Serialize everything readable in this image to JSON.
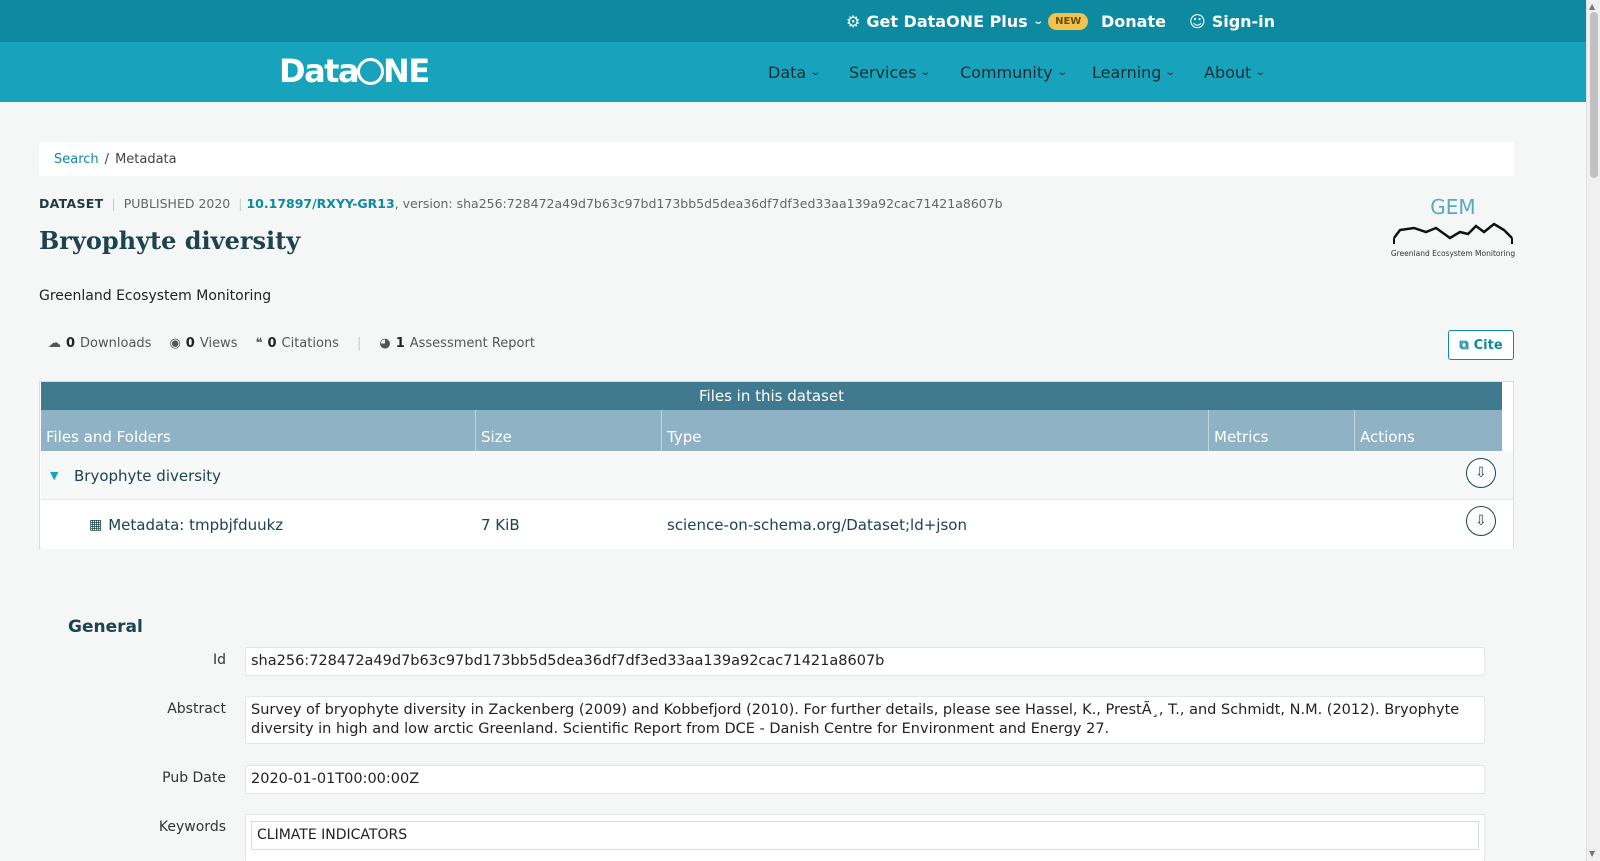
{
  "topbar": {
    "plus_label": "Get DataONE Plus",
    "new_badge": "NEW",
    "donate_label": "Donate",
    "signin_label": "Sign-in"
  },
  "navbar": {
    "logo_left": "Data",
    "logo_right": "NE",
    "items": [
      "Data",
      "Services",
      "Community",
      "Learning",
      "About"
    ]
  },
  "breadcrumb": {
    "search": "Search",
    "separator": "/",
    "current": "Metadata"
  },
  "dataset": {
    "type": "DATASET",
    "published": "PUBLISHED 2020",
    "doi": "10.17897/RXYY-GR13",
    "version": ", version: sha256:728472a49d7b63c97bd173bb5d5dea36df7df3ed33aa139a92cac71421a8607b",
    "title": "Bryophyte diversity",
    "organization": "Greenland Ecosystem Monitoring",
    "gem_logo_text": "GEM",
    "gem_logo_caption": "Greenland Ecosystem Monitoring"
  },
  "metrics": {
    "downloads_count": "0",
    "downloads_label": "Downloads",
    "views_count": "0",
    "views_label": "Views",
    "citations_count": "0",
    "citations_label": "Citations",
    "assessment_count": "1",
    "assessment_label": "Assessment Report"
  },
  "cite_label": "Cite",
  "files": {
    "title": "Files in this dataset",
    "headers": [
      "Files and Folders",
      "Size",
      "Type",
      "Metrics",
      "Actions"
    ],
    "package": {
      "name": "Bryophyte diversity"
    },
    "rows": [
      {
        "name": "Metadata: tmpbjfduukz",
        "size": "7 KiB",
        "type": "science-on-schema.org/Dataset;ld+json"
      }
    ]
  },
  "general": {
    "section_title": "General",
    "id_label": "Id",
    "id_value": "sha256:728472a49d7b63c97bd173bb5d5dea36df7df3ed33aa139a92cac71421a8607b",
    "abstract_label": "Abstract",
    "abstract_value": "Survey of bryophyte diversity in Zackenberg (2009) and Kobbefjord (2010). For further details, please see Hassel, K., PrestÃ¸, T., and Schmidt, N.M. (2012). Bryophyte diversity in high and low arctic Greenland. Scientific Report from DCE - Danish Centre for Environment and Energy 27.",
    "pubdate_label": "Pub Date",
    "pubdate_value": "2020-01-01T00:00:00Z",
    "keywords_label": "Keywords",
    "keywords": [
      "CLIMATE INDICATORS"
    ]
  },
  "colors": {
    "topbar": "#0e8aa0",
    "navbar": "#17a3bb",
    "accent": "#0e8aa0",
    "table_title": "#3f7a8e",
    "table_header": "#8fb3c4"
  }
}
